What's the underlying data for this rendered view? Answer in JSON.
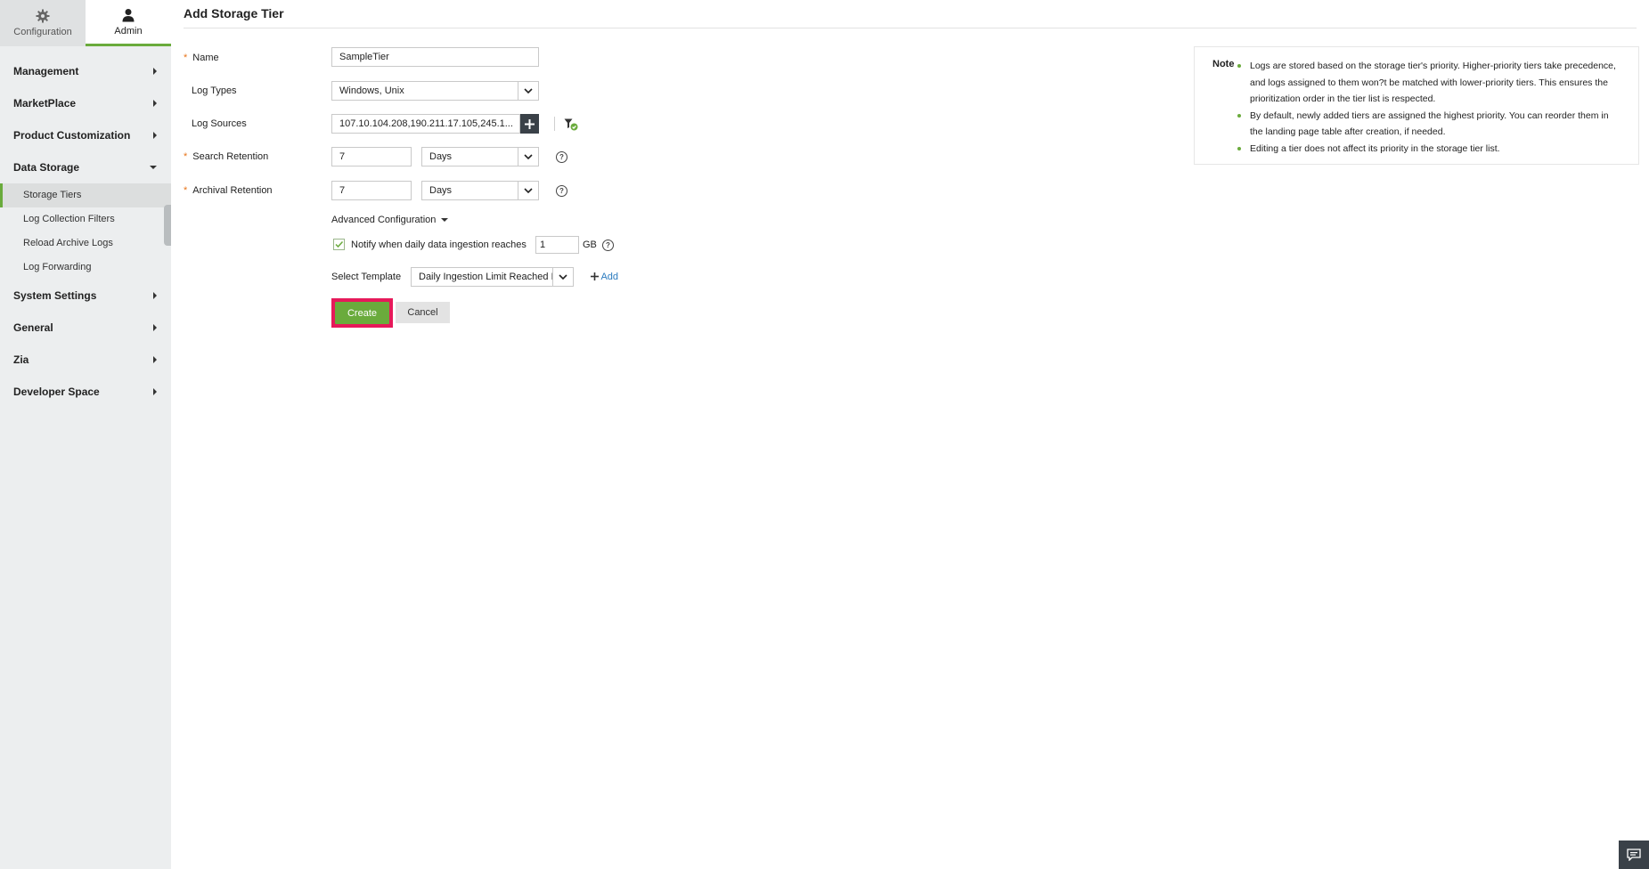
{
  "topnav": {
    "configuration_label": "Configuration",
    "admin_label": "Admin"
  },
  "sidebar": {
    "items": [
      {
        "label": "Management"
      },
      {
        "label": "MarketPlace"
      },
      {
        "label": "Product Customization"
      },
      {
        "label": "Data Storage"
      },
      {
        "label": "System Settings"
      },
      {
        "label": "General"
      },
      {
        "label": "Zia"
      },
      {
        "label": "Developer Space"
      }
    ],
    "data_storage_sub": [
      {
        "label": "Storage Tiers"
      },
      {
        "label": "Log Collection Filters"
      },
      {
        "label": "Reload Archive Logs"
      },
      {
        "label": "Log Forwarding"
      }
    ]
  },
  "page": {
    "title": "Add Storage Tier"
  },
  "form": {
    "name_label": "Name",
    "name_value": "SampleTier",
    "log_types_label": "Log Types",
    "log_types_value": "Windows, Unix",
    "log_sources_label": "Log Sources",
    "log_sources_value": "107.10.104.208,190.211.17.105,245.1...",
    "search_retention_label": "Search Retention",
    "search_retention_value": "7",
    "search_retention_unit": "Days",
    "archival_retention_label": "Archival Retention",
    "archival_retention_value": "7",
    "archival_retention_unit": "Days",
    "advanced_label": "Advanced Configuration",
    "notify_label": "Notify when daily data ingestion reaches",
    "notify_value": "1",
    "notify_unit": "GB",
    "notify_checked": true,
    "template_label": "Select Template",
    "template_value": "Daily Ingestion Limit Reached N",
    "add_label": "Add",
    "create_label": "Create",
    "cancel_label": "Cancel",
    "help_glyph": "?"
  },
  "note": {
    "title": "Note",
    "items": [
      "Logs are stored based on the storage tier's priority. Higher-priority tiers take precedence, and logs assigned to them won?t be matched with lower-priority tiers. This ensures the prioritization order in the tier list is respected.",
      "By default, newly added tiers are assigned the highest priority. You can reorder them in the landing page table after creation, if needed.",
      "Editing a tier does not affect its priority in the storage tier list."
    ]
  },
  "colors": {
    "accent": "#6aab3c",
    "highlight": "#e6195a",
    "dark": "#3a4148",
    "required": "#e8741a",
    "link": "#2b7bbf"
  }
}
